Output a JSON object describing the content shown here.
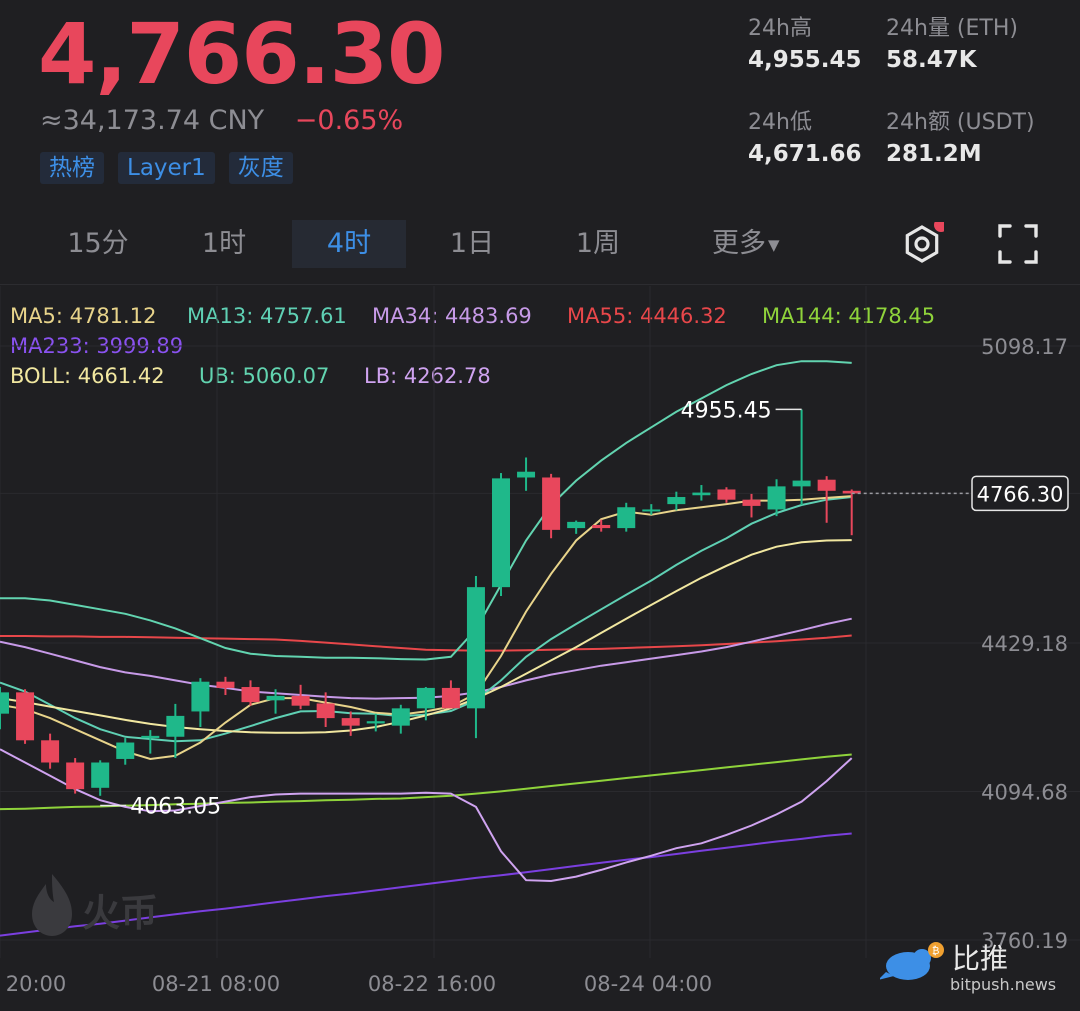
{
  "header": {
    "price": "4,766.30",
    "cny": "≈34,173.74 CNY",
    "change": "−0.65%",
    "tags": [
      "热榜",
      "Layer1",
      "灰度"
    ]
  },
  "stats": {
    "high_label": "24h高",
    "high": "4,955.45",
    "vol_label": "24h量 (ETH)",
    "vol": "58.47K",
    "low_label": "24h低",
    "low": "4,671.66",
    "amt_label": "24h额 (USDT)",
    "amt": "281.2M"
  },
  "timeframes": {
    "items": [
      "15分",
      "1时",
      "4时",
      "1日",
      "1周"
    ],
    "active": "4时",
    "more": "更多"
  },
  "toolbar": {
    "settings_icon": "gear-icon",
    "fullscreen_icon": "fullscreen-icon"
  },
  "indicators": {
    "ma5": "MA5: 4781.12",
    "ma13": "MA13: 4757.61",
    "ma34": "MA34: 4483.69",
    "ma55": "MA55: 4446.32",
    "ma144": "MA144: 4178.45",
    "ma233": "MA233: 3999.89",
    "boll": "BOLL: 4661.42",
    "ub": "UB: 5060.07",
    "lb": "LB: 4262.78"
  },
  "colors": {
    "up": "#1fb88a",
    "down": "#e8475c",
    "ma5": "#e8d48b",
    "ma13": "#5fd0b4",
    "ma34": "#c79ae8",
    "ma55": "#e8474a",
    "ma144": "#8fd33b",
    "ma233": "#7b3fe0",
    "boll": "#f1e7a0",
    "band": "#62d4b0",
    "lb": "#cfa3f0",
    "accent": "#3d8fe6"
  },
  "watermark": "火币",
  "brand": {
    "name": "比推",
    "url": "bitpush.news"
  },
  "chart_data": {
    "type": "candlestick",
    "interval": "4h",
    "x_labels": [
      "20:00",
      "08-21 08:00",
      "08-22 16:00",
      "08-24 04:00"
    ],
    "y_ticks": [
      5098.17,
      4766.3,
      4429.18,
      4094.68,
      3760.19
    ],
    "y_tick_labels": [
      "5098.17",
      "4766.30",
      "4429.18",
      "4094.68",
      "3760.19"
    ],
    "current_price": 4766.3,
    "current_price_label": "4766.30",
    "high_marker": 4955.45,
    "high_marker_label": "4955.45",
    "low_marker": 4063.05,
    "low_marker_label": "4063.05",
    "candles": [
      {
        "o": 4270,
        "h": 4330,
        "l": 4235,
        "c": 4318
      },
      {
        "o": 4318,
        "h": 4325,
        "l": 4202,
        "c": 4210
      },
      {
        "o": 4210,
        "h": 4225,
        "l": 4146,
        "c": 4160
      },
      {
        "o": 4160,
        "h": 4170,
        "l": 4090,
        "c": 4100
      },
      {
        "o": 4103,
        "h": 4165,
        "l": 4085,
        "c": 4160
      },
      {
        "o": 4168,
        "h": 4215,
        "l": 4155,
        "c": 4205
      },
      {
        "o": 4215,
        "h": 4233,
        "l": 4180,
        "c": 4220
      },
      {
        "o": 4218,
        "h": 4292,
        "l": 4170,
        "c": 4265
      },
      {
        "o": 4275,
        "h": 4350,
        "l": 4240,
        "c": 4342
      },
      {
        "o": 4342,
        "h": 4353,
        "l": 4312,
        "c": 4328
      },
      {
        "o": 4330,
        "h": 4345,
        "l": 4288,
        "c": 4296
      },
      {
        "o": 4300,
        "h": 4325,
        "l": 4270,
        "c": 4310
      },
      {
        "o": 4310,
        "h": 4335,
        "l": 4280,
        "c": 4288
      },
      {
        "o": 4293,
        "h": 4318,
        "l": 4240,
        "c": 4260
      },
      {
        "o": 4260,
        "h": 4275,
        "l": 4220,
        "c": 4243
      },
      {
        "o": 4248,
        "h": 4270,
        "l": 4230,
        "c": 4253
      },
      {
        "o": 4243,
        "h": 4290,
        "l": 4225,
        "c": 4282
      },
      {
        "o": 4282,
        "h": 4330,
        "l": 4255,
        "c": 4328
      },
      {
        "o": 4328,
        "h": 4345,
        "l": 4300,
        "c": 4282
      },
      {
        "o": 4282,
        "h": 4580,
        "l": 4215,
        "c": 4555
      },
      {
        "o": 4555,
        "h": 4812,
        "l": 4535,
        "c": 4800
      },
      {
        "o": 4802,
        "h": 4847,
        "l": 4772,
        "c": 4815
      },
      {
        "o": 4802,
        "h": 4810,
        "l": 4665,
        "c": 4684
      },
      {
        "o": 4688,
        "h": 4705,
        "l": 4675,
        "c": 4702
      },
      {
        "o": 4695,
        "h": 4707,
        "l": 4680,
        "c": 4688
      },
      {
        "o": 4688,
        "h": 4745,
        "l": 4680,
        "c": 4735
      },
      {
        "o": 4728,
        "h": 4742,
        "l": 4718,
        "c": 4730
      },
      {
        "o": 4742,
        "h": 4770,
        "l": 4728,
        "c": 4758
      },
      {
        "o": 4762,
        "h": 4785,
        "l": 4750,
        "c": 4768
      },
      {
        "o": 4775,
        "h": 4780,
        "l": 4745,
        "c": 4752
      },
      {
        "o": 4752,
        "h": 4765,
        "l": 4712,
        "c": 4738
      },
      {
        "o": 4730,
        "h": 4798,
        "l": 4715,
        "c": 4782
      },
      {
        "o": 4782,
        "h": 4955,
        "l": 4740,
        "c": 4795
      },
      {
        "o": 4797,
        "h": 4805,
        "l": 4700,
        "c": 4772
      },
      {
        "o": 4772,
        "h": 4775,
        "l": 4672,
        "c": 4766
      }
    ],
    "lines": {
      "ma5": [
        4290,
        4280,
        4260,
        4235,
        4210,
        4185,
        4168,
        4175,
        4205,
        4250,
        4290,
        4305,
        4305,
        4295,
        4285,
        4272,
        4268,
        4275,
        4286,
        4315,
        4400,
        4500,
        4585,
        4660,
        4708,
        4725,
        4718,
        4728,
        4735,
        4742,
        4750,
        4750,
        4752,
        4756,
        4760
      ],
      "ma13": [
        4340,
        4320,
        4290,
        4260,
        4235,
        4218,
        4213,
        4208,
        4210,
        4225,
        4242,
        4260,
        4275,
        4276,
        4271,
        4270,
        4264,
        4268,
        4276,
        4300,
        4345,
        4398,
        4438,
        4472,
        4505,
        4538,
        4570,
        4605,
        4637,
        4665,
        4698,
        4722,
        4740,
        4752,
        4758
      ],
      "ma34": [
        4432,
        4420,
        4405,
        4390,
        4375,
        4363,
        4355,
        4345,
        4335,
        4328,
        4320,
        4316,
        4312,
        4308,
        4305,
        4304,
        4305,
        4306,
        4310,
        4318,
        4330,
        4345,
        4358,
        4368,
        4378,
        4386,
        4394,
        4402,
        4410,
        4420,
        4432,
        4445,
        4458,
        4472,
        4484
      ],
      "ma55": [
        4445,
        4445,
        4444,
        4444,
        4443,
        4443,
        4442,
        4441,
        4440,
        4439,
        4438,
        4437,
        4434,
        4430,
        4426,
        4422,
        4418,
        4414,
        4413,
        4412,
        4412,
        4413,
        4414,
        4415,
        4416,
        4418,
        4420,
        4422,
        4424,
        4427,
        4430,
        4433,
        4437,
        4441,
        4446
      ],
      "ma144": [
        4055,
        4056,
        4058,
        4060,
        4061,
        4063,
        4064,
        4066,
        4067,
        4069,
        4070,
        4072,
        4073,
        4075,
        4076,
        4078,
        4079,
        4082,
        4085,
        4090,
        4095,
        4101,
        4107,
        4113,
        4119,
        4125,
        4131,
        4137,
        4143,
        4149,
        4155,
        4161,
        4167,
        4173,
        4178
      ],
      "ma233": [
        3770,
        3777,
        3784,
        3791,
        3797,
        3804,
        3811,
        3818,
        3825,
        3831,
        3838,
        3845,
        3852,
        3859,
        3865,
        3872,
        3879,
        3886,
        3893,
        3900,
        3906,
        3913,
        3920,
        3927,
        3934,
        3941,
        3947,
        3954,
        3961,
        3968,
        3975,
        3982,
        3988,
        3995,
        4000
      ],
      "boll": [
        4305,
        4296,
        4286,
        4276,
        4266,
        4256,
        4247,
        4240,
        4235,
        4231,
        4228,
        4227,
        4227,
        4228,
        4232,
        4240,
        4252,
        4266,
        4282,
        4304,
        4330,
        4360,
        4390,
        4420,
        4452,
        4484,
        4515,
        4546,
        4576,
        4603,
        4628,
        4646,
        4656,
        4660,
        4661
      ],
      "ub": [
        4530,
        4530,
        4525,
        4515,
        4505,
        4495,
        4480,
        4462,
        4440,
        4418,
        4405,
        4400,
        4398,
        4396,
        4396,
        4395,
        4393,
        4392,
        4398,
        4460,
        4560,
        4660,
        4740,
        4795,
        4840,
        4880,
        4915,
        4950,
        4980,
        5010,
        5035,
        5055,
        5064,
        5064,
        5060
      ],
      "lb": [
        4190,
        4160,
        4130,
        4100,
        4075,
        4060,
        4050,
        4052,
        4062,
        4072,
        4082,
        4088,
        4090,
        4090,
        4090,
        4090,
        4090,
        4092,
        4090,
        4060,
        3960,
        3895,
        3893,
        3903,
        3918,
        3935,
        3950,
        3967,
        3978,
        3997,
        4018,
        4043,
        4072,
        4118,
        4170
      ]
    }
  }
}
